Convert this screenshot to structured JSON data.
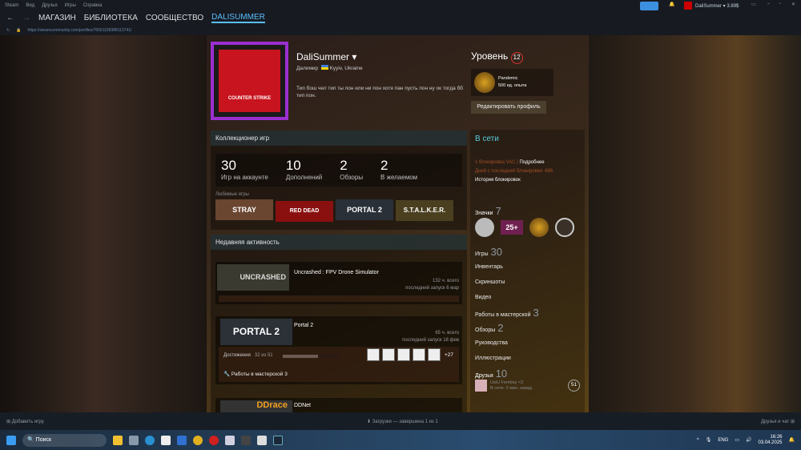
{
  "titlebar": {
    "menu": [
      "Steam",
      "Вид",
      "Друзья",
      "Игры",
      "Справка"
    ],
    "account": "DaliSummer",
    "balance": "3.89$"
  },
  "nav": {
    "items": [
      "МАГАЗИН",
      "БИБЛИОТЕКА",
      "СООБЩЕСТВО",
      "DALISUMMER"
    ]
  },
  "url": "https://steamcommunity.com/profiles/76561199388113741/",
  "profile": {
    "name": "DaliSummer",
    "real_name": "Далимир",
    "location": "Kyyiv, Ukraine",
    "summary": "Тип бош чел тип ты пон или ни пон хотя пан пусть пон ну ок тогда бб тип пон.",
    "avatar_text": "COUNTER STRIKE"
  },
  "level": {
    "label": "Уровень",
    "value": "12",
    "badge_name": "Pandemic",
    "badge_xp": "500 ед. опыта",
    "edit": "Редактировать профиль"
  },
  "showcase": {
    "title": "Коллекционер игр",
    "stats": [
      {
        "n": "30",
        "l": "Игр на аккаунте"
      },
      {
        "n": "10",
        "l": "Дополнений"
      },
      {
        "n": "2",
        "l": "Обзоры"
      },
      {
        "n": "2",
        "l": "В желаемом"
      }
    ],
    "fav_label": "Любимые игры",
    "favs": [
      "STRAY",
      "RED DEAD",
      "PORTAL 2",
      "S.T.A.L.K.E.R."
    ]
  },
  "activity": {
    "title": "Недавняя активность",
    "games": [
      {
        "name": "Uncrashed : FPV Drone Simulator",
        "logo": "UNCRASHED",
        "hours": "132 ч. всего",
        "last": "последний запуск 6 мар"
      },
      {
        "name": "Portal 2",
        "logo": "PORTAL 2",
        "hours": "65 ч. всего",
        "last": "последний запуск 18 фев",
        "ach_label": "Достижения",
        "ach_value": "32 из 51",
        "ach_progress": 0.63,
        "ach_more": "+27",
        "workshop": "Работы в мастерской 3"
      },
      {
        "name": "DDNet",
        "logo": "DDrace"
      }
    ]
  },
  "sidebar": {
    "status": "В сети",
    "vac": "1 блокировка VAC",
    "details": "Подробнее",
    "days": "Дней с последней блокировки: 686",
    "history": "История блокировок",
    "badges_label": "Значки",
    "badges_count": "7",
    "links": [
      {
        "l": "Игры",
        "c": "30"
      },
      {
        "l": "Инвентарь"
      },
      {
        "l": "Скриншоты"
      },
      {
        "l": "Видео"
      },
      {
        "l": "Работы в мастерской",
        "c": "3"
      },
      {
        "l": "Обзоры",
        "c": "2"
      },
      {
        "l": "Руководства"
      },
      {
        "l": "Иллюстрации"
      }
    ],
    "friends_label": "Друзья",
    "friends_count": "10",
    "friend": {
      "name": "UwU Femboy <3",
      "status": "В сети: 2 мин. назад",
      "level": "51"
    }
  },
  "bottombar": {
    "add": "Добавить игру",
    "downloads": "Загрузки — завершена 1 из 1",
    "friends": "Друзья и чат"
  },
  "taskbar": {
    "search": "Поиск",
    "lang": "ENG",
    "time": "16:26",
    "date": "03.04.2025"
  }
}
